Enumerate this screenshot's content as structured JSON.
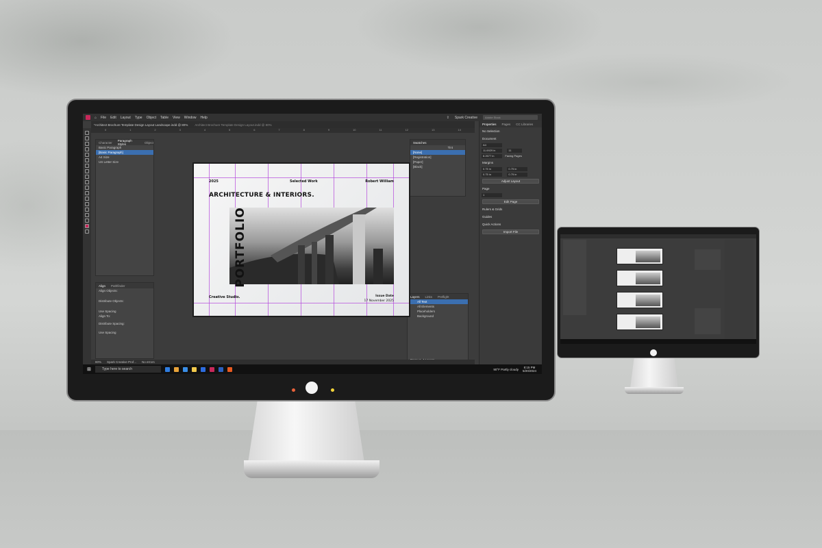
{
  "menu": {
    "items": [
      "File",
      "Edit",
      "Layout",
      "Type",
      "Object",
      "Table",
      "View",
      "Window",
      "Help"
    ],
    "workspace": "Spark Creative",
    "search_placeholder": "Adobe Stock"
  },
  "tabs": {
    "active": "*Architect Brochure Template Design Layout Landscape.indd @ 80%",
    "inactive": "Architect Brochure Template Design Layout.indd @ 80%"
  },
  "ruler_ticks": [
    "0",
    "1",
    "2",
    "3",
    "4",
    "5",
    "6",
    "7",
    "8",
    "9",
    "10",
    "11",
    "12",
    "13",
    "14"
  ],
  "paragraph_panel": {
    "tabs": [
      "Character",
      "Paragraph Styles",
      "Object"
    ],
    "rows": [
      "Basic Paragraph",
      "[Basic Paragraph]",
      "A4 Size",
      "US Letter Size"
    ]
  },
  "align_panel": {
    "tabs": [
      "Align",
      "Pathfinder"
    ],
    "labels": [
      "Align Objects:",
      "Distribute Objects:",
      "Use Spacing",
      "Align To:",
      "Distribute Spacing:",
      "Use Spacing"
    ]
  },
  "swatches_panel": {
    "title": "Swatches",
    "tint_label": "Tint",
    "rows": [
      "[None]",
      "[Registration]",
      "[Paper]",
      "[Black]"
    ]
  },
  "layers_panel": {
    "tabs": [
      "Layers",
      "Links",
      "Preflight"
    ],
    "rows": [
      "All Text",
      "All Elements",
      "Placeholders",
      "Background"
    ],
    "footer": "Page: 1, 4 Layers"
  },
  "document": {
    "year": "2025",
    "selected_work": "Selected Work",
    "author": "Robert William",
    "title": "ARCHITECTURE & INTERIORS.",
    "portfolio": "PORTFOLIO",
    "studio": "Creative Studio.",
    "issue": "Issue Date",
    "issue_date": "17 November 2025"
  },
  "status": {
    "zoom": "80%",
    "profile": "Spark Creative Prof...",
    "errors": "No errors"
  },
  "taskbar": {
    "search_placeholder": "Type here to search",
    "weather": "90°F  Partly cloudy",
    "time": "8:15 PM",
    "date": "5/20/2024",
    "colors": [
      "#2f7de0",
      "#e8a33a",
      "#3a8ee6",
      "#f2c94c",
      "#2d6cdf",
      "#e0a43a",
      "#3c74c8",
      "#c8285a",
      "#2b5fbd",
      "#e85a20",
      "#d44",
      "#5a5a5a"
    ]
  },
  "properties_panel": {
    "tabs": [
      "Properties",
      "Pages",
      "CC Libraries"
    ],
    "no_selection": "No Selection",
    "document_label": "Document",
    "page_size": "A4",
    "width": "11.6929 in",
    "height": "8.2677 in",
    "pages_count": "11",
    "facing_pages": "Facing Pages",
    "margins_label": "Margins",
    "margin_values": [
      "0.75 in",
      "0.75 in",
      "0.75 in",
      "0.75 in"
    ],
    "adjust_layout": "Adjust Layout",
    "page_label": "Page",
    "page_value": "1",
    "edit_page": "Edit Page",
    "rulers_grids": "Rulers & Grids",
    "guides": "Guides",
    "quick_actions": "Quick Actions",
    "import_file": "Import File"
  },
  "colors": {
    "app_accent": "#c8285a",
    "guide": "#b446dc",
    "selection": "#3b6fb0"
  }
}
